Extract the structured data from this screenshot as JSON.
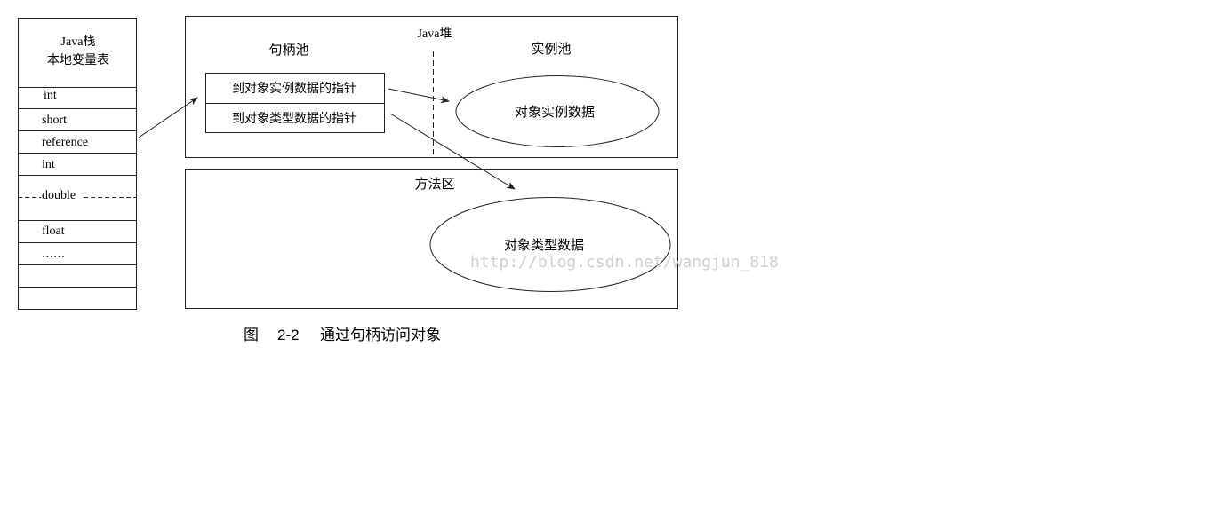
{
  "stack": {
    "title_line1": "Java栈",
    "title_line2": "本地变量表",
    "slots": [
      "int",
      "short",
      "reference",
      "int",
      "double",
      "float",
      "……",
      "",
      ""
    ]
  },
  "heap": {
    "title": "Java堆",
    "handle_pool_label": "句柄池",
    "instance_pool_label": "实例池",
    "handle_rows": [
      "到对象实例数据的指针",
      "到对象类型数据的指针"
    ],
    "instance_data_label": "对象实例数据"
  },
  "method_area": {
    "title": "方法区",
    "type_data_label": "对象类型数据"
  },
  "watermark": "http://blog.csdn.net/wangjun_818",
  "caption": {
    "figure_label": "图",
    "figure_number": "2-2",
    "figure_title": "通过句柄访问对象"
  },
  "colors": {
    "line": "#222222",
    "watermark": "#cfcfcf"
  }
}
